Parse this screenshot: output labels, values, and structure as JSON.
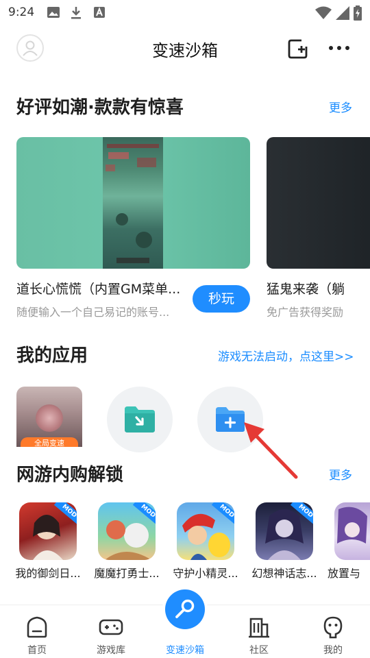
{
  "status_bar": {
    "time": "9:24"
  },
  "header": {
    "title": "变速沙箱"
  },
  "featured": {
    "title": "好评如潮·款款有惊喜",
    "more_label": "更多",
    "cards": [
      {
        "title": "道长心慌慌（内置GM菜单...",
        "subtitle": "随便输入一个自己易记的账号...",
        "play_label": "秒玩"
      },
      {
        "title": "猛鬼来袭（躺",
        "subtitle": "免广告获得奖励"
      }
    ]
  },
  "my_apps": {
    "title": "我的应用",
    "help_link": "游戏无法启动，点这里>>",
    "app_tag": "全局变速"
  },
  "mod_section": {
    "title": "网游内购解锁",
    "more_label": "更多",
    "badge": "MOD",
    "games": [
      {
        "name": "我的御剑日..."
      },
      {
        "name": "魔魔打勇士..."
      },
      {
        "name": "守护小精灵..."
      },
      {
        "name": "幻想神话志..."
      },
      {
        "name": "放置与"
      }
    ]
  },
  "bottom_nav": {
    "items": [
      {
        "label": "首页"
      },
      {
        "label": "游戏库"
      },
      {
        "label": "变速沙箱"
      },
      {
        "label": "社区"
      },
      {
        "label": "我的"
      }
    ]
  },
  "colors": {
    "accent": "#1f8dff",
    "arrow": "#e53935"
  }
}
